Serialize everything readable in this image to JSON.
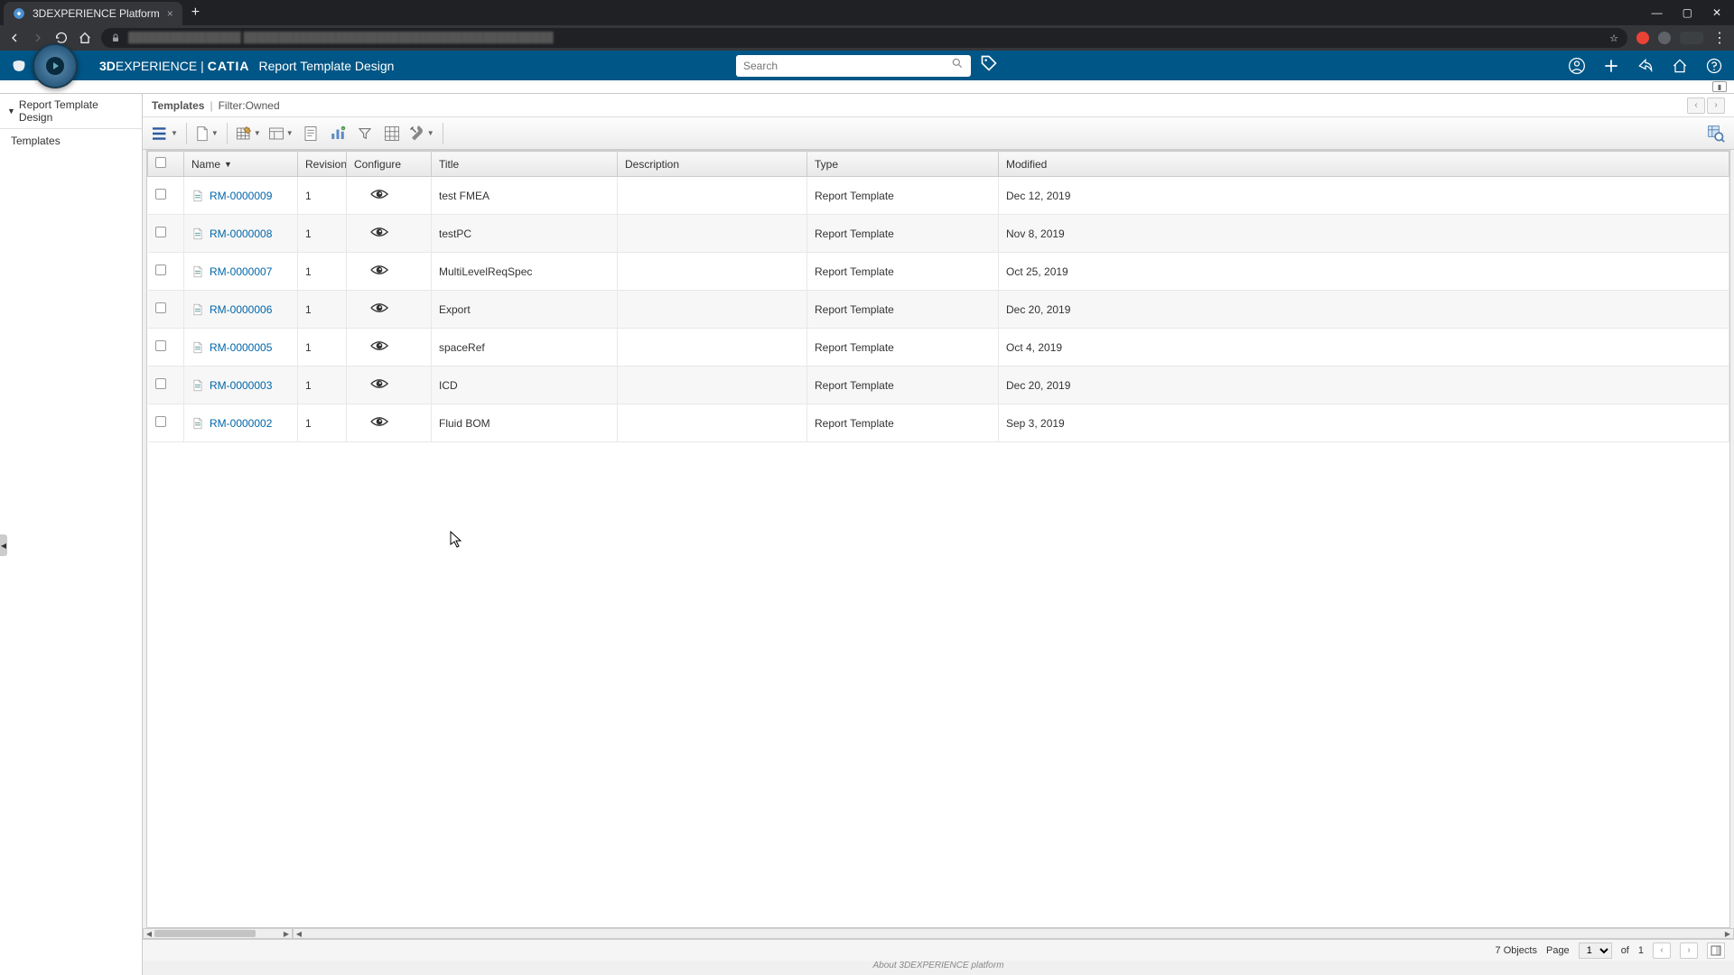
{
  "browser": {
    "tab_title": "3DEXPERIENCE Platform",
    "url_display": "████████████████ ████████████████████████████████████████████"
  },
  "header": {
    "brand_prefix": "3D",
    "brand_rest": "EXPERIENCE",
    "brand_sep": "|",
    "brand_suite": "CATIA",
    "app_name": "Report Template Design",
    "search_placeholder": "Search"
  },
  "sidebar": {
    "root": "Report Template Design",
    "items": [
      "Templates"
    ]
  },
  "breadcrumb": {
    "main": "Templates",
    "filter_label": "Filter:Owned"
  },
  "table": {
    "columns": {
      "name": "Name",
      "revision": "Revision",
      "configure": "Configure",
      "title": "Title",
      "description": "Description",
      "type": "Type",
      "modified": "Modified"
    },
    "rows": [
      {
        "name": "RM-0000009",
        "revision": "1",
        "title": "test FMEA",
        "description": "",
        "type": "Report Template",
        "modified": "Dec 12, 2019"
      },
      {
        "name": "RM-0000008",
        "revision": "1",
        "title": "testPC",
        "description": "",
        "type": "Report Template",
        "modified": "Nov 8, 2019"
      },
      {
        "name": "RM-0000007",
        "revision": "1",
        "title": "MultiLevelReqSpec",
        "description": "",
        "type": "Report Template",
        "modified": "Oct 25, 2019"
      },
      {
        "name": "RM-0000006",
        "revision": "1",
        "title": "Export",
        "description": "",
        "type": "Report Template",
        "modified": "Dec 20, 2019"
      },
      {
        "name": "RM-0000005",
        "revision": "1",
        "title": "spaceRef",
        "description": "",
        "type": "Report Template",
        "modified": "Oct 4, 2019"
      },
      {
        "name": "RM-0000003",
        "revision": "1",
        "title": "ICD",
        "description": "",
        "type": "Report Template",
        "modified": "Dec 20, 2019"
      },
      {
        "name": "RM-0000002",
        "revision": "1",
        "title": "Fluid BOM",
        "description": "",
        "type": "Report Template",
        "modified": "Sep 3, 2019"
      }
    ]
  },
  "footer": {
    "object_count": "7 Objects",
    "page_label": "Page",
    "page_current": "1",
    "page_of": "of",
    "page_total": "1"
  },
  "about": "About 3DEXPERIENCE platform"
}
